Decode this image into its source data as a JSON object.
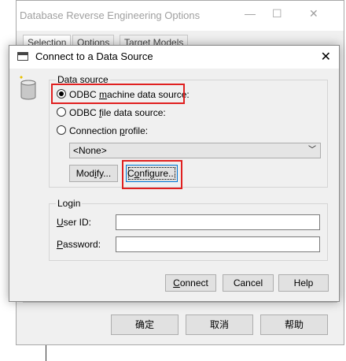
{
  "background_window": {
    "title": "Database Reverse Engineering Options",
    "controls": [
      "—",
      "☐",
      "✕"
    ],
    "tabs": [
      "Selection",
      "Options",
      "Target Models"
    ],
    "buttons": {
      "ok": "确定",
      "cancel": "取消",
      "help": "帮助"
    }
  },
  "dialog": {
    "title": "Connect to a Data Source",
    "close": "✕",
    "data_source": {
      "group_label": "Data source",
      "options": [
        {
          "pre": "ODBC ",
          "key": "m",
          "post": "achine data source:",
          "checked": true
        },
        {
          "pre": "ODBC ",
          "key": "f",
          "post": "ile data source:",
          "checked": false
        },
        {
          "pre": "Connection ",
          "key": "p",
          "post": "rofile:",
          "checked": false
        }
      ],
      "profile_select": {
        "value": "<None>",
        "chevron": "﹀"
      },
      "modify_button": {
        "pre": "Mod",
        "key": "i",
        "post": "fy..."
      },
      "configure_button": {
        "pre": "C",
        "key": "o",
        "post": "nfigure..."
      }
    },
    "login": {
      "group_label": "Login",
      "user_id": {
        "key": "U",
        "post": "ser ID:",
        "value": ""
      },
      "password": {
        "key": "P",
        "post": "assword:",
        "value": ""
      }
    },
    "buttons": {
      "connect": {
        "key": "C",
        "post": "onnect"
      },
      "cancel": "Cancel",
      "help": "Help"
    }
  },
  "highlight_color": "#e02020"
}
